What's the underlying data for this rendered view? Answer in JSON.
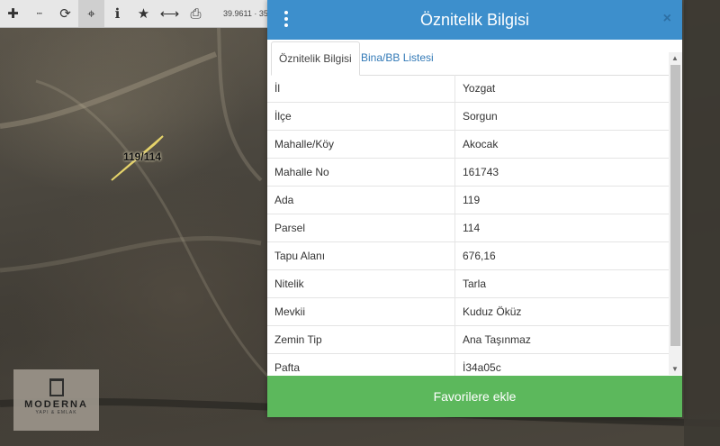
{
  "toolbar": {
    "tools": [
      {
        "icon": "pan-icon",
        "glyph": "✚"
      },
      {
        "icon": "measure-icon",
        "glyph": "···"
      },
      {
        "icon": "refresh-icon",
        "glyph": "⟳"
      },
      {
        "icon": "locate-icon",
        "glyph": "⌖"
      },
      {
        "icon": "info-icon",
        "glyph": "ℹ"
      },
      {
        "icon": "favorite-star-icon",
        "glyph": "★"
      },
      {
        "icon": "distance-icon",
        "glyph": "⟷"
      },
      {
        "icon": "print-icon",
        "glyph": "⎙"
      }
    ],
    "coordinates": "39.9611 · 35"
  },
  "map": {
    "parcel_label": "119/114",
    "watermark": "MODERNA",
    "watermark_sub": "YAPI & EMLAK"
  },
  "dialog": {
    "title": "Öznitelik Bilgisi",
    "close_label": "×",
    "tabs": [
      {
        "label": "Öznitelik Bilgisi",
        "active": true
      },
      {
        "label": "Bina/BB Listesi",
        "active": false
      }
    ],
    "rows": [
      {
        "key": "İl",
        "value": "Yozgat"
      },
      {
        "key": "İlçe",
        "value": "Sorgun"
      },
      {
        "key": "Mahalle/Köy",
        "value": "Akocak"
      },
      {
        "key": "Mahalle No",
        "value": "161743"
      },
      {
        "key": "Ada",
        "value": "119"
      },
      {
        "key": "Parsel",
        "value": "114"
      },
      {
        "key": "Tapu Alanı",
        "value": "676,16"
      },
      {
        "key": "Nitelik",
        "value": "Tarla"
      },
      {
        "key": "Mevkii",
        "value": "Kuduz Öküz"
      },
      {
        "key": "Zemin Tip",
        "value": "Ana Taşınmaz"
      },
      {
        "key": "Pafta",
        "value": "İ34a05c"
      }
    ],
    "favorite_button": "Favorilere ekle"
  },
  "colors": {
    "header": "#3d8fcc",
    "button": "#5cb85c",
    "parcel_outline": "#e5d36a"
  }
}
